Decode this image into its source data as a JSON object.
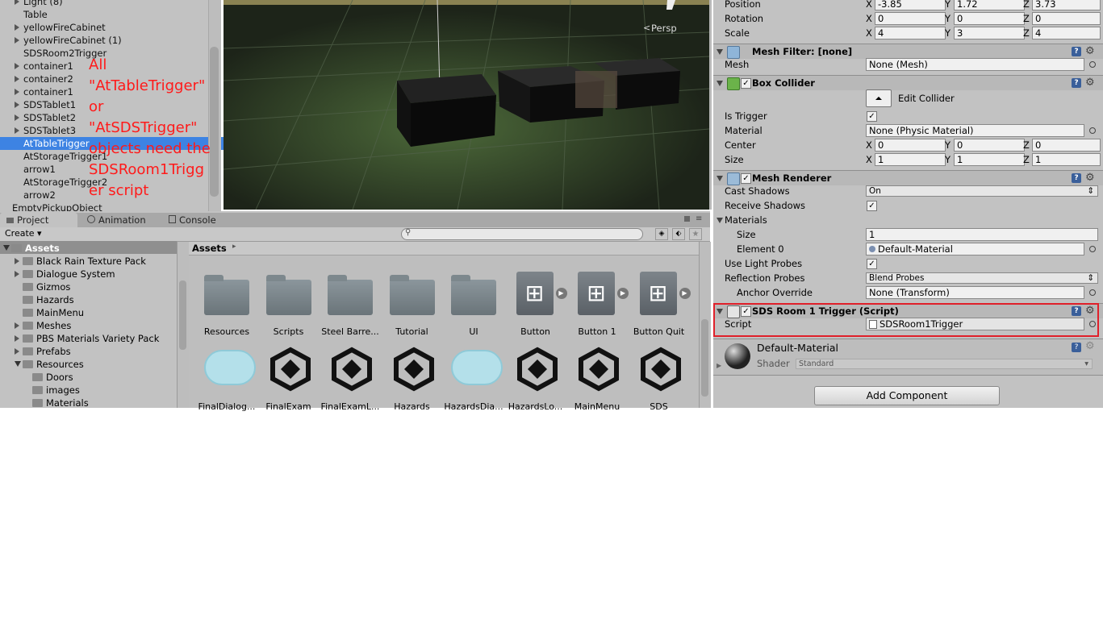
{
  "hierarchy": {
    "items": [
      {
        "label": "Light (8)",
        "arrow": true
      },
      {
        "label": "Table",
        "arrow": false
      },
      {
        "label": "yellowFireCabinet",
        "arrow": true
      },
      {
        "label": "yellowFireCabinet (1)",
        "arrow": true
      },
      {
        "label": "SDSRoom2Trigger",
        "arrow": false
      },
      {
        "label": "container1",
        "arrow": true
      },
      {
        "label": "container2",
        "arrow": true
      },
      {
        "label": "container1",
        "arrow": true
      },
      {
        "label": "SDSTablet1",
        "arrow": true
      },
      {
        "label": "SDSTablet2",
        "arrow": true
      },
      {
        "label": "SDSTablet3",
        "arrow": true
      },
      {
        "label": "AtTableTrigger",
        "arrow": false,
        "selected": true
      },
      {
        "label": "AtStorageTrigger1",
        "arrow": false
      },
      {
        "label": "arrow1",
        "arrow": false
      },
      {
        "label": "AtStorageTrigger2",
        "arrow": false
      },
      {
        "label": "arrow2",
        "arrow": false
      },
      {
        "label": "EmptyPickupObject",
        "arrow": false
      }
    ],
    "annotation": [
      "All",
      "\"AtTableTrigger\"",
      "or",
      "\"AtSDSTrigger\"",
      "objects need the",
      "SDSRoom1Trigg",
      "er script"
    ]
  },
  "scene": {
    "persp_label": "Persp"
  },
  "tabs": {
    "project": "Project",
    "animation": "Animation",
    "console": "Console"
  },
  "toolbar": {
    "create_label": "Create",
    "search_placeholder": ""
  },
  "tree": {
    "items": [
      {
        "label": "Assets",
        "level": 0,
        "arrow": true,
        "selected": true,
        "bold": true
      },
      {
        "label": "Black Rain Texture Pack",
        "level": 1,
        "arrow": true
      },
      {
        "label": "Dialogue System",
        "level": 1,
        "arrow": true
      },
      {
        "label": "Gizmos",
        "level": 1,
        "arrow": false
      },
      {
        "label": "Hazards",
        "level": 1,
        "arrow": false
      },
      {
        "label": "MainMenu",
        "level": 1,
        "arrow": false
      },
      {
        "label": "Meshes",
        "level": 1,
        "arrow": true
      },
      {
        "label": "PBS Materials Variety Pack",
        "level": 1,
        "arrow": true
      },
      {
        "label": "Prefabs",
        "level": 1,
        "arrow": true
      },
      {
        "label": "Resources",
        "level": 1,
        "arrow": true
      },
      {
        "label": "Doors",
        "level": 2,
        "arrow": false
      },
      {
        "label": "images",
        "level": 2,
        "arrow": false
      },
      {
        "label": "Materials",
        "level": 2,
        "arrow": false
      }
    ]
  },
  "assets": {
    "breadcrumb": "Assets",
    "row1": [
      {
        "label": "Resources",
        "kind": "folder"
      },
      {
        "label": "Scripts",
        "kind": "folder"
      },
      {
        "label": "Steel Barre...",
        "kind": "folder"
      },
      {
        "label": "Tutorial",
        "kind": "folder"
      },
      {
        "label": "UI",
        "kind": "folder"
      },
      {
        "label": "Button",
        "kind": "anim"
      },
      {
        "label": "Button 1",
        "kind": "anim"
      },
      {
        "label": "Button Quit",
        "kind": "anim"
      }
    ],
    "row2": [
      {
        "label": "FinalDialog...",
        "kind": "dialogue"
      },
      {
        "label": "FinalExam",
        "kind": "unity"
      },
      {
        "label": "FinalExamL...",
        "kind": "unity"
      },
      {
        "label": "Hazards",
        "kind": "unity"
      },
      {
        "label": "HazardsDia...",
        "kind": "dialogue"
      },
      {
        "label": "HazardsLo...",
        "kind": "unity"
      },
      {
        "label": "MainMenu",
        "kind": "unity"
      },
      {
        "label": "SDS",
        "kind": "unity"
      }
    ]
  },
  "inspector": {
    "transform": {
      "position_label": "Position",
      "position": [
        "-3.85",
        "1.72",
        "3.73"
      ],
      "rotation_label": "Rotation",
      "rotation": [
        "0",
        "0",
        "0"
      ],
      "scale_label": "Scale",
      "scale": [
        "4",
        "3",
        "4"
      ]
    },
    "mesh_filter": {
      "title": "Mesh Filter: [none]",
      "mesh_label": "Mesh",
      "mesh_value": "None (Mesh)"
    },
    "box_collider": {
      "title": "Box Collider",
      "edit_label": "Edit Collider",
      "is_trigger_label": "Is Trigger",
      "material_label": "Material",
      "material_value": "None (Physic Material)",
      "center_label": "Center",
      "center": [
        "0",
        "0",
        "0"
      ],
      "size_label": "Size",
      "size": [
        "1",
        "1",
        "1"
      ]
    },
    "mesh_renderer": {
      "title": "Mesh Renderer",
      "cast_shadows_label": "Cast Shadows",
      "cast_shadows_value": "On",
      "receive_shadows_label": "Receive Shadows",
      "materials_label": "Materials",
      "size_label": "Size",
      "size_value": "1",
      "element0_label": "Element 0",
      "element0_value": "Default-Material",
      "light_probes_label": "Use Light Probes",
      "reflection_label": "Reflection Probes",
      "reflection_value": "Blend Probes",
      "anchor_label": "Anchor Override",
      "anchor_value": "None (Transform)"
    },
    "script_comp": {
      "title": "SDS Room 1 Trigger (Script)",
      "script_label": "Script",
      "script_value": "SDSRoom1Trigger"
    },
    "material": {
      "name": "Default-Material",
      "shader_label": "Shader",
      "shader_value": "Standard"
    },
    "add_component": "Add Component"
  },
  "colors": {
    "selection": "#3d83e3",
    "annotation": "#ff1a1a",
    "highlight_box": "#e0202a"
  }
}
